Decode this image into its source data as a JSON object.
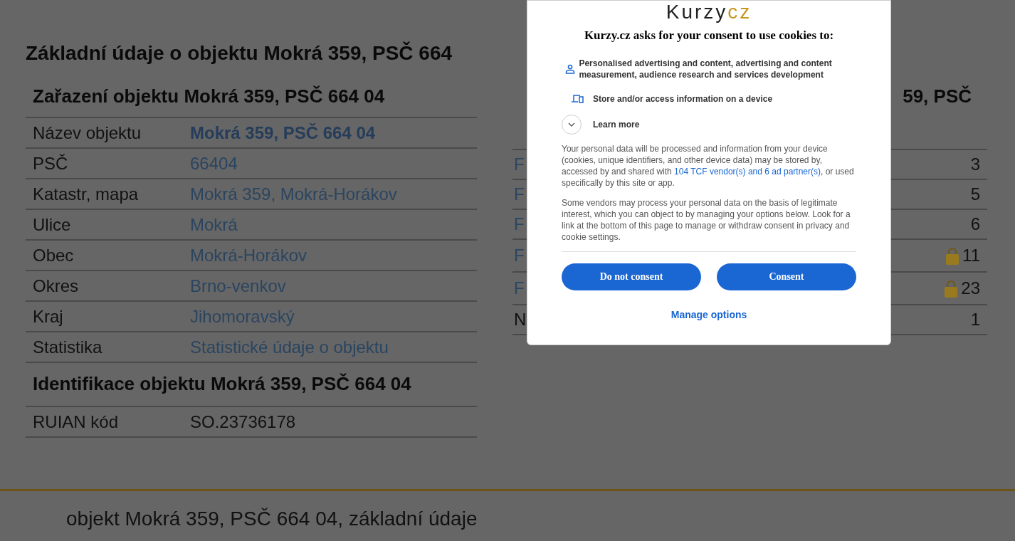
{
  "page_title": "Základní údaje o objektu Mokrá 359, PSČ 664",
  "classification": {
    "title": "Zařazení objektu Mokrá 359, PSČ 664 04",
    "rows": [
      {
        "label": "Název objektu",
        "value": "Mokrá 359, PSČ 664 04",
        "kind": "bold-link"
      },
      {
        "label": "PSČ",
        "value": "66404",
        "kind": "link"
      },
      {
        "label": "Katastr, mapa",
        "value": "Mokrá 359, Mokrá-Horákov",
        "kind": "link"
      },
      {
        "label": "Ulice",
        "value": "Mokrá",
        "kind": "link"
      },
      {
        "label": "Obec",
        "value": "Mokrá-Horákov",
        "kind": "link"
      },
      {
        "label": "Okres",
        "value": "Brno-venkov",
        "kind": "link"
      },
      {
        "label": "Kraj",
        "value": "Jihomoravský",
        "kind": "link"
      },
      {
        "label": "Statistika",
        "value": "Statistické údaje o objektu",
        "kind": "link"
      }
    ]
  },
  "identification": {
    "title": "Identifikace objektu Mokrá 359, PSČ 664 04",
    "rows": [
      {
        "label": "RUIAN kód",
        "value": "SO.23736178",
        "kind": "plain"
      }
    ]
  },
  "side_table": {
    "title": "59, PSČ",
    "rows": [
      {
        "label": "F",
        "value": "3",
        "locked": false,
        "kind": "link"
      },
      {
        "label": "F",
        "value": "5",
        "locked": false,
        "kind": "link"
      },
      {
        "label": "F",
        "value": "6",
        "locked": false,
        "kind": "link"
      },
      {
        "label": "F",
        "value": "11",
        "locked": true,
        "kind": "link"
      },
      {
        "label": "F",
        "value": "23",
        "locked": true,
        "kind": "link"
      },
      {
        "label": "N",
        "value": "1",
        "locked": false,
        "kind": "plain"
      }
    ]
  },
  "footer": "objekt Mokrá 359, PSČ 664 04, základní údaje",
  "consent": {
    "logo": {
      "text": "Kurzy",
      "accent": "cz"
    },
    "title": "Kurzy.cz asks for your consent to use cookies to:",
    "purposes": [
      {
        "kind": "person",
        "text": "Personalised advertising and content, advertising and content measurement, audience research and services development"
      },
      {
        "kind": "device",
        "text": "Store and/or access information on a device"
      }
    ],
    "learn_more": {
      "label": "Learn more",
      "expanded": false
    },
    "paragraph_1": {
      "before": "Your personal data will be processed and information from your device (cookies, unique identifiers, and other device data) may be stored by, accessed by and shared with ",
      "link": "104 TCF vendor(s) and 6 ad partner(s)",
      "after": ", or used specifically by this site or app."
    },
    "paragraph_2": "Some vendors may process your personal data on the basis of legitimate interest, which you can object to by managing your options below. Look for a link at the bottom of this page to manage or withdraw consent in privacy and cookie settings.",
    "buttons": [
      "Do not consent",
      "Consent"
    ],
    "manage": "Manage options"
  }
}
